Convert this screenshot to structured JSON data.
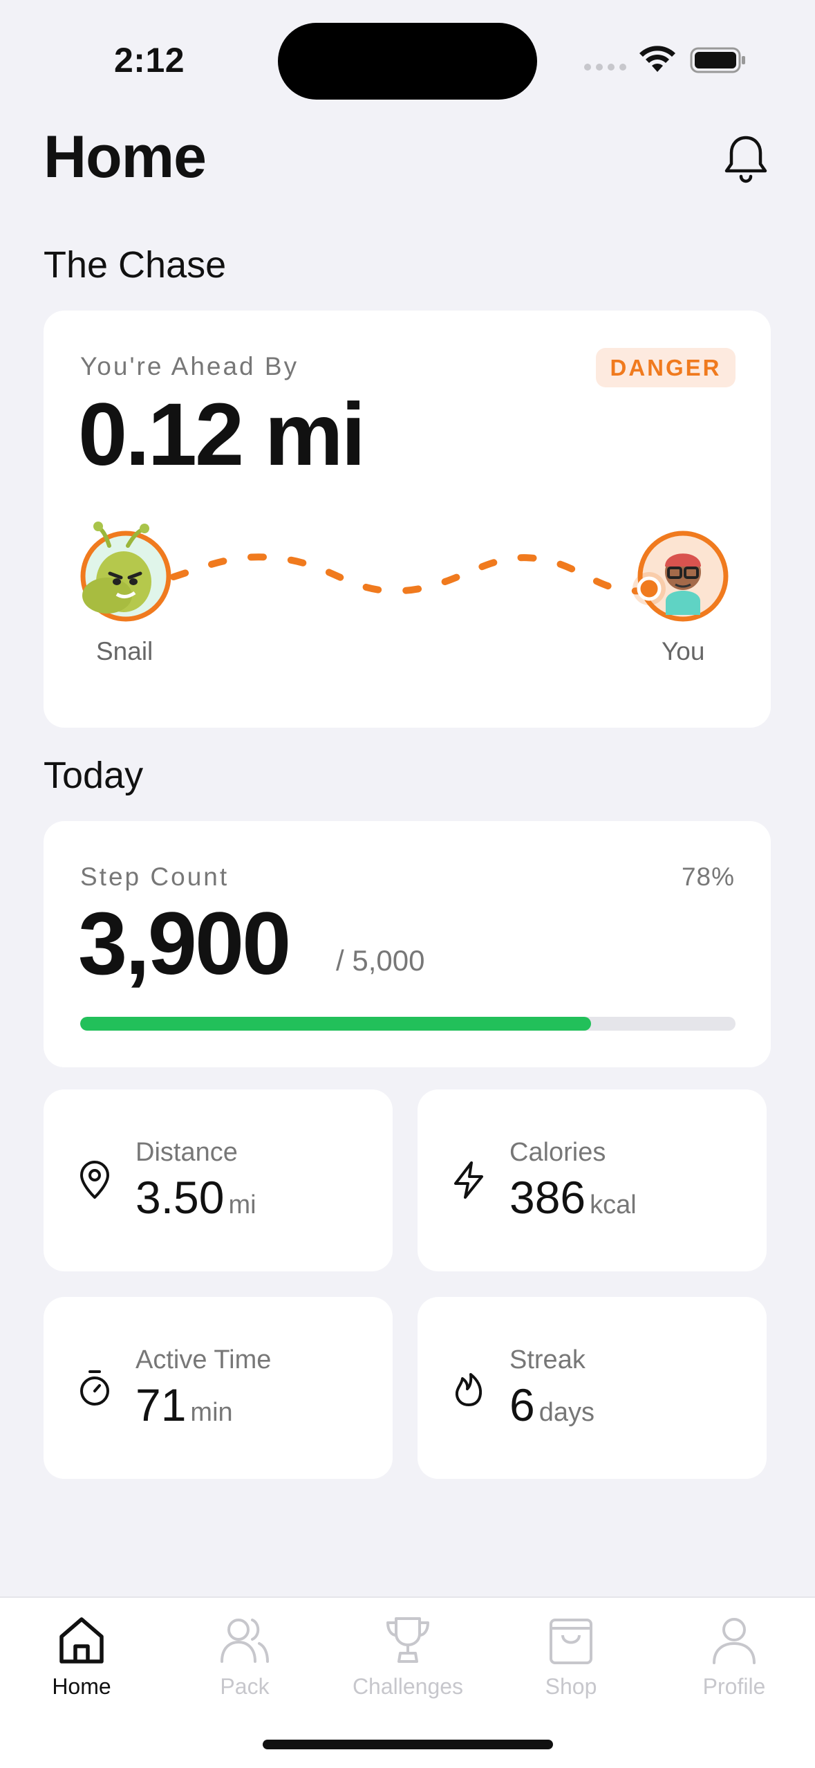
{
  "status_bar": {
    "time": "2:12"
  },
  "header": {
    "title": "Home"
  },
  "chase": {
    "section_title": "The Chase",
    "label": "You're Ahead By",
    "badge": "DANGER",
    "value": "0.12 mi",
    "left_avatar": {
      "name": "Snail",
      "icon": "snail-avatar-icon"
    },
    "right_avatar": {
      "name": "You",
      "icon": "user-avatar-icon"
    }
  },
  "today": {
    "section_title": "Today",
    "steps": {
      "label": "Step Count",
      "percent": "78%",
      "value": "3,900",
      "goal": "/ 5,000",
      "progress": 0.78
    },
    "stats": [
      {
        "label": "Distance",
        "value": "3.50",
        "unit": "mi",
        "icon": "location-pin-icon"
      },
      {
        "label": "Calories",
        "value": "386",
        "unit": "kcal",
        "icon": "lightning-icon"
      },
      {
        "label": "Active Time",
        "value": "71",
        "unit": "min",
        "icon": "stopwatch-icon"
      },
      {
        "label": "Streak",
        "value": "6",
        "unit": "days",
        "icon": "flame-icon"
      }
    ]
  },
  "tabs": [
    {
      "label": "Home",
      "icon": "home-icon",
      "active": true
    },
    {
      "label": "Pack",
      "icon": "people-icon",
      "active": false
    },
    {
      "label": "Challenges",
      "icon": "trophy-icon",
      "active": false
    },
    {
      "label": "Shop",
      "icon": "shopping-bag-icon",
      "active": false
    },
    {
      "label": "Profile",
      "icon": "person-icon",
      "active": false
    }
  ],
  "colors": {
    "accent": "#F07A1E",
    "progress": "#22C05A",
    "background": "#F2F2F7",
    "inactive_tab": "#C7C7CC"
  }
}
